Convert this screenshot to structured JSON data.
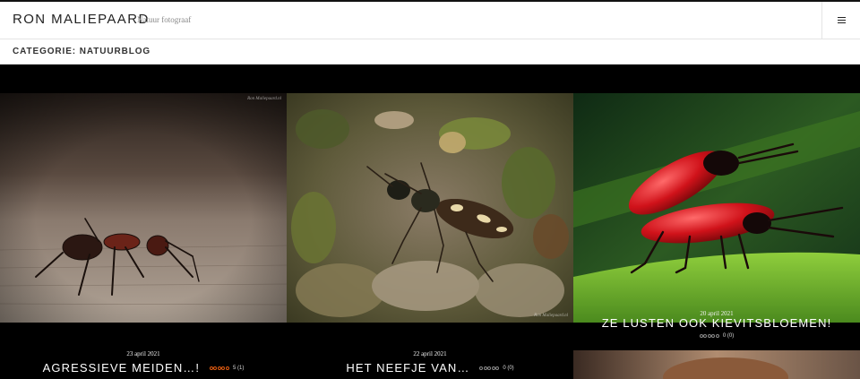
{
  "site": {
    "title": "RON MALIEPAARD",
    "tagline": "Natuur fotograaf"
  },
  "menu": {
    "icon": "hamburger-menu-icon"
  },
  "category": {
    "title": "CATEGORIE: NATUURBLOG"
  },
  "watermark": "Ron Maliepaard.nl",
  "posts": [
    {
      "date": "23 april 2021",
      "title": "AGRESSIEVE MEIDEN…!",
      "rating_value": 5,
      "rating_count": "(1)",
      "rating_text": "5 (1)",
      "star_color": "#e05a10"
    },
    {
      "date": "22 april 2021",
      "title": "HET NEEFJE VAN…",
      "rating_value": 0,
      "rating_count": "(0)",
      "rating_text": "0 (0)",
      "star_color": "#9a9a9a"
    },
    {
      "date": "20 april 2021",
      "title": "ZE LUSTEN OOK KIEVITSBLOEMEN!",
      "rating_value": 0,
      "rating_count": "(0)",
      "rating_text": "0 (0)",
      "star_color": "#9a9a9a"
    }
  ],
  "colors": {
    "header_bg": "#ffffff",
    "content_bg": "#000000",
    "text_dark": "#222222"
  }
}
